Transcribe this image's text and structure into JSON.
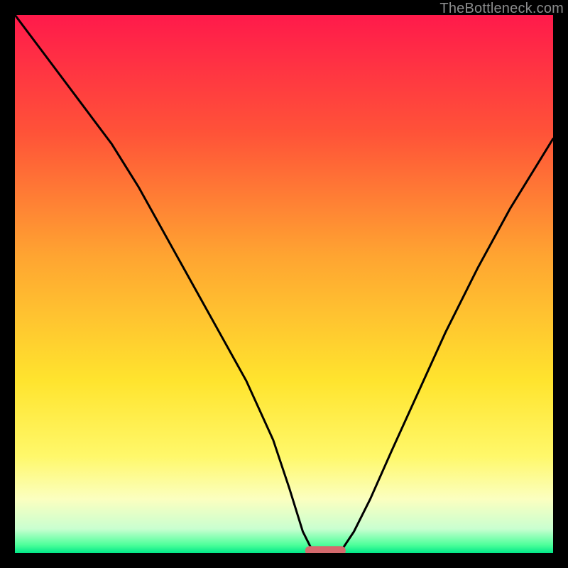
{
  "watermark": "TheBottleneck.com",
  "chart_data": {
    "type": "line",
    "title": "",
    "xlabel": "",
    "ylabel": "",
    "xlim": [
      0,
      100
    ],
    "ylim": [
      0,
      100
    ],
    "gradient_stops": [
      {
        "offset": 0,
        "color": "#ff1a4b"
      },
      {
        "offset": 0.22,
        "color": "#ff5338"
      },
      {
        "offset": 0.45,
        "color": "#ffa531"
      },
      {
        "offset": 0.68,
        "color": "#ffe42e"
      },
      {
        "offset": 0.82,
        "color": "#fff86a"
      },
      {
        "offset": 0.9,
        "color": "#fbffc0"
      },
      {
        "offset": 0.955,
        "color": "#c9ffd0"
      },
      {
        "offset": 0.985,
        "color": "#4dff9a"
      },
      {
        "offset": 1.0,
        "color": "#00e888"
      }
    ],
    "series": [
      {
        "name": "bottleneck-curve",
        "x": [
          0,
          6,
          12,
          18,
          23,
          28,
          33,
          38,
          43,
          48,
          51,
          53.5,
          55,
          57,
          59,
          61,
          63,
          66,
          70,
          75,
          80,
          86,
          92,
          100
        ],
        "y": [
          100,
          92,
          84,
          76,
          68,
          59,
          50,
          41,
          32,
          21,
          12,
          4,
          1,
          0.5,
          0.5,
          1,
          4,
          10,
          19,
          30,
          41,
          53,
          64,
          77
        ]
      }
    ],
    "marker": {
      "name": "optimal-range",
      "x_center": 57.7,
      "y": 0.5,
      "width": 7.5,
      "color": "#d56a6d"
    }
  }
}
